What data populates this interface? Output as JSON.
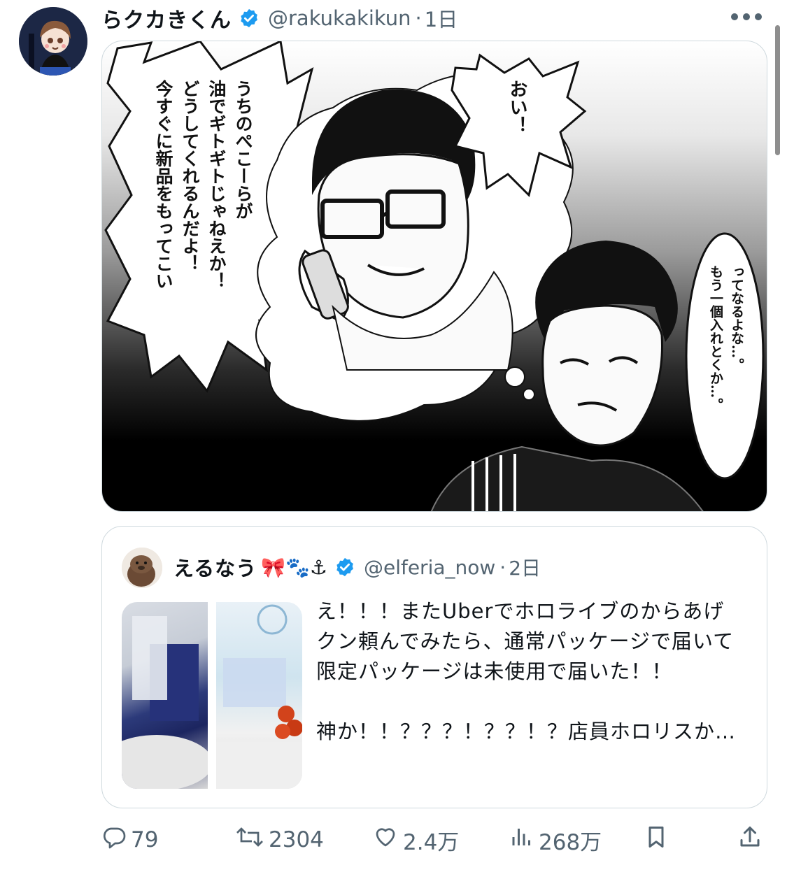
{
  "tweet": {
    "author_name": "らクカきくん",
    "handle": "@rakukakikun",
    "separator": "·",
    "time": "1日",
    "manga_lines": {
      "big_bubble": [
        "うちのぺこーらが",
        "油でギトギトじゃねえか！",
        "どうしてくれるんだよ！",
        "今すぐに新品をもってこい"
      ],
      "small_bubble": "おい！",
      "side_bubble": [
        "ってなるよな…。",
        "もう一個入れとくか…。"
      ]
    }
  },
  "quote": {
    "author_name": "えるなう",
    "emojis": "🎀🐾⚓",
    "handle": "@elferia_now",
    "separator": "·",
    "time": "2日",
    "text_lines": [
      "え！！！またUberでホロライブのからあげ",
      "クン頼んでみたら、通常パッケージで届いて",
      "限定パッケージは未使用で届いた！！",
      "",
      "神か！！？？？！？？！？店員ホロリスか…"
    ]
  },
  "actions": {
    "replies": "79",
    "reposts": "2304",
    "likes": "2.4万",
    "views": "268万"
  },
  "colors": {
    "text": "#0f1419",
    "secondary": "#536471",
    "verified": "#1d9bf0",
    "border": "#cfd9de"
  }
}
